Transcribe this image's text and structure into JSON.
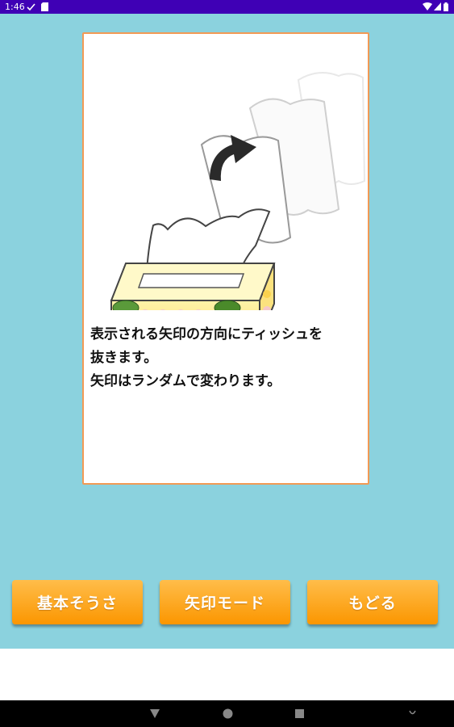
{
  "status_bar": {
    "time": "1:46",
    "icons": [
      "check-icon",
      "sd-card-icon",
      "wifi-icon",
      "signal-icon",
      "battery-icon"
    ]
  },
  "instruction": {
    "lines": [
      "表示される矢印の方向にティッシュを",
      "抜きます。",
      "矢印はランダムで変わります。"
    ]
  },
  "buttons": {
    "basic": "基本そうさ",
    "arrow_mode": "矢印モード",
    "back": "もどる"
  },
  "nav": {
    "icons": [
      "back-icon",
      "home-icon",
      "recents-icon",
      "assistant-icon"
    ]
  },
  "colors": {
    "background": "#8bd2de",
    "button": "#fb9600",
    "card_border": "#f29a55",
    "status_bar": "#3f00b5"
  }
}
